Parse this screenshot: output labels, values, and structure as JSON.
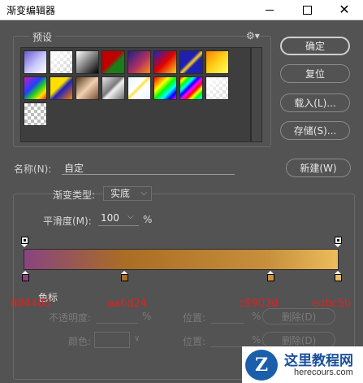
{
  "window": {
    "title": "渐变编辑器"
  },
  "presets": {
    "label": "预设",
    "swatches": [
      {
        "bg": "linear-gradient(135deg,#6a5acd,#c8c8ff 55%,#ffffff)"
      },
      {
        "bg": "linear-gradient(135deg,#ffffff,rgba(255,255,255,0)), repeating-conic-gradient(#cfcfcf 0 25%, #ffffff 0 50%) 0 0/8px 8px"
      },
      {
        "bg": "linear-gradient(135deg,#ffffff,#000000)"
      },
      {
        "bg": "linear-gradient(135deg,#c00000,#c00000 45%,#1a7d1a 60%,#1a7d1a)"
      },
      {
        "bg": "linear-gradient(135deg,#1f1f8a,#b03060 55%,#ff8c1a)"
      },
      {
        "bg": "linear-gradient(135deg,#2020c0,#e00000 50%,#ffd21a)"
      },
      {
        "bg": "linear-gradient(135deg,#2020b0,#2020b0 42%,#ffd21a 52%,#2020b0 62%,#2020b0)"
      },
      {
        "bg": "linear-gradient(135deg,#ff8000,#ffd21a 50%,#ffff60)"
      },
      {
        "bg": "linear-gradient(135deg,#c020c0,#2040ff 40%,#20d020 60%,#ffe000 80%,#ff2020)"
      },
      {
        "bg": "linear-gradient(135deg,#ffe000,#ffe000 40%,#2020c0 55%,#ff8000)"
      },
      {
        "bg": "linear-gradient(135deg,#5a3a20,#f0d0b0 50%,#7a4a30)"
      },
      {
        "bg": "linear-gradient(135deg,#e8e8e8,#7a7a7a 45%,#f0f0f0 55%,#6a6a6a)"
      },
      {
        "bg": "linear-gradient(135deg,#e8f4ff,#ffffff 40%,#ffe040 48%,#ffffff 56%,#e8f4ff)"
      },
      {
        "bg": "linear-gradient(135deg,#ff0000,#ff8000 17%,#ffff00 33%,#00ff00 50%,#00ffff 67%,#0000ff 83%,#ff00ff)"
      },
      {
        "bg": "repeating-linear-gradient(135deg,#ff0000 0,#ffff00 4px,#00ff00 8px,#00ffff 12px,#0000ff 16px,#ff00ff 20px,#ff0000 24px)"
      },
      {
        "bg": "linear-gradient(135deg,#ffffff,rgba(255,255,255,0.2)), repeating-conic-gradient(#cfcfcf 0 25%, #ffffff 0 50%) 0 0/8px 8px"
      },
      {
        "bg": "repeating-conic-gradient(#bdbdbd 0 25%, #ffffff 0 50%) 0 0/8px 8px"
      }
    ]
  },
  "buttons": {
    "ok": "确定",
    "reset": "复位",
    "load": "载入(L)...",
    "save": "存储(S)...",
    "new": "新建(W)"
  },
  "name": {
    "label": "名称(N):",
    "value": "自定"
  },
  "gradient_type": {
    "label": "渐变类型:",
    "value": "实底",
    "smoothness_label": "平滑度(M):",
    "smoothness_value": "100",
    "smoothness_unit": "%"
  },
  "gradient": {
    "colors": [
      "#884480",
      "#aa6d24",
      "#c8903d",
      "#edbc5b"
    ],
    "bar_css": "linear-gradient(to right,#884480 0%,#aa6d24 32%,#c8903d 78%,#edbc5b 100%)"
  },
  "annotations": [
    "884480",
    "aa6d24",
    "c8903d",
    "edbc5b"
  ],
  "color_stops": {
    "label": "色标",
    "opacity_label": "不透明度:",
    "opacity_unit": "%",
    "position_label": "位置:",
    "position_unit": "%",
    "delete_label": "删除(D)",
    "color_label": "颜色:",
    "color_chevron": "∨"
  },
  "watermark": {
    "logo_letter": "Z",
    "title": "这里教程网",
    "url": "herecours.com"
  },
  "icons": {
    "gear": "⚙▾",
    "select_chevron": "⌵"
  }
}
